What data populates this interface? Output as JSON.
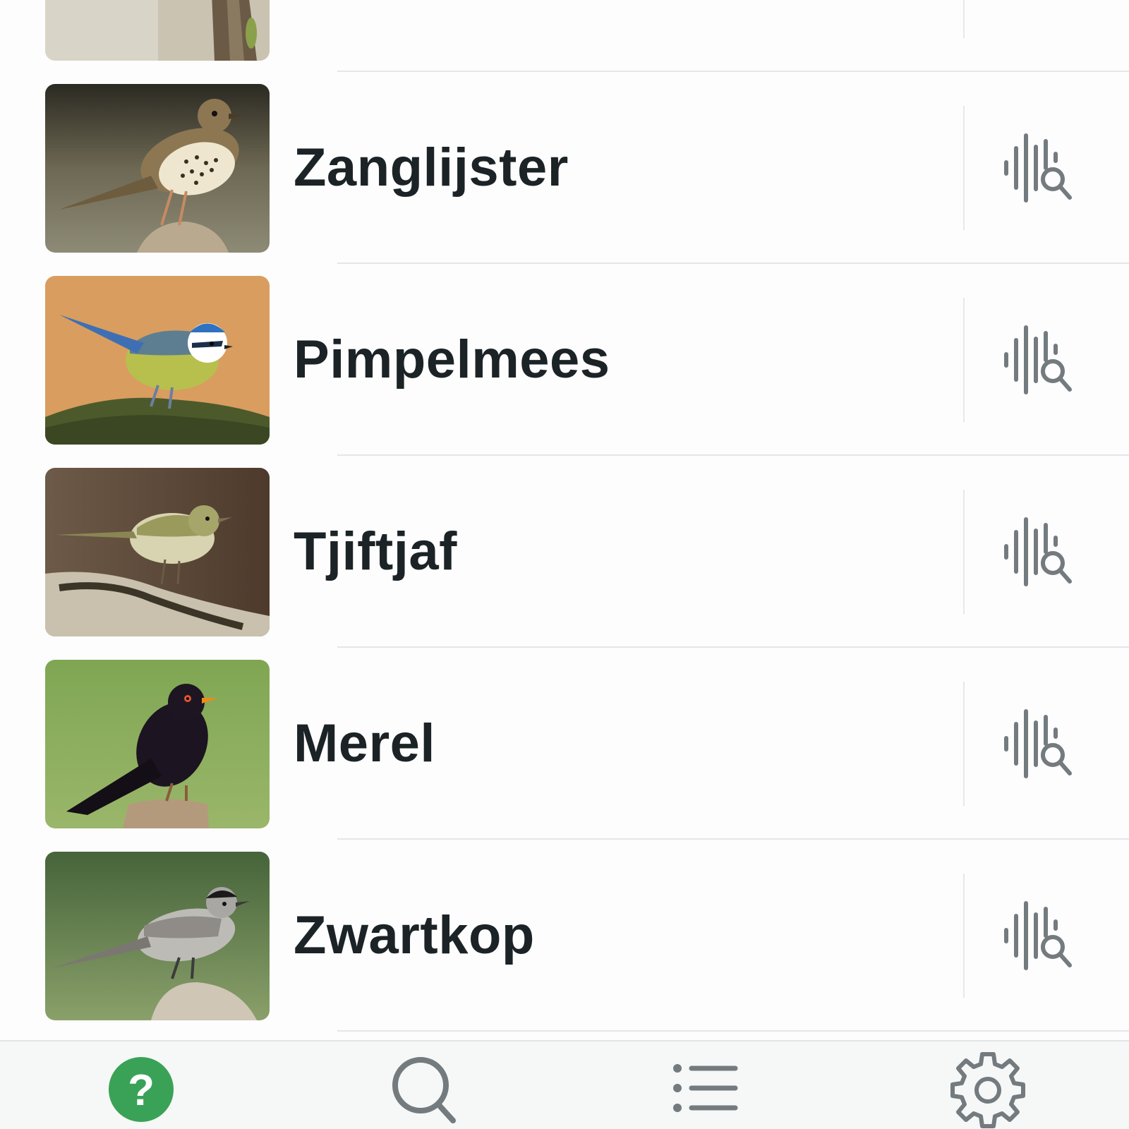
{
  "colors": {
    "accent_green": "#3aa256",
    "icon_gray": "#737b7e",
    "text_dark": "#1c2326",
    "tabbar_bg": "#f6f7f7"
  },
  "birds": [
    {
      "name": "",
      "photo": "bird-photo-partial",
      "action_icon": "sound-search-icon"
    },
    {
      "name": "Zanglijster",
      "photo": "song-thrush-photo",
      "action_icon": "sound-search-icon"
    },
    {
      "name": "Pimpelmees",
      "photo": "blue-tit-photo",
      "action_icon": "sound-search-icon"
    },
    {
      "name": "Tjiftjaf",
      "photo": "chiffchaff-photo",
      "action_icon": "sound-search-icon"
    },
    {
      "name": "Merel",
      "photo": "blackbird-photo",
      "action_icon": "sound-search-icon"
    },
    {
      "name": "Zwartkop",
      "photo": "blackcap-photo",
      "action_icon": "sound-search-icon"
    }
  ],
  "tabbar": {
    "tabs": [
      {
        "icon": "question-mark-icon",
        "active": true,
        "glyph": "?"
      },
      {
        "icon": "search-icon",
        "active": false
      },
      {
        "icon": "list-icon",
        "active": false
      },
      {
        "icon": "gear-icon",
        "active": false
      }
    ]
  }
}
